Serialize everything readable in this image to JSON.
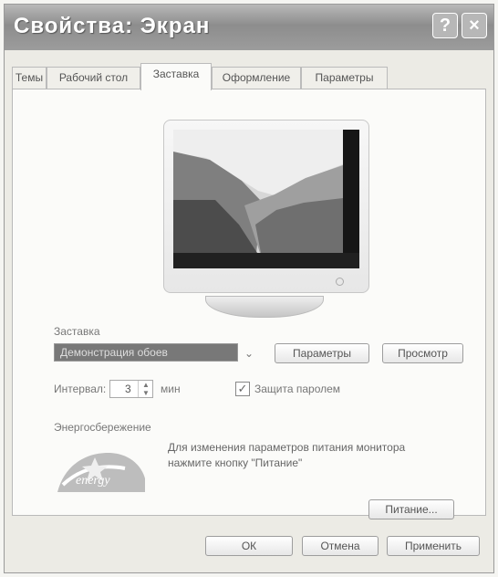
{
  "window": {
    "title": "Свойства: Экран",
    "help_button": "?",
    "close_button": "×"
  },
  "tabs": [
    {
      "label": "Темы"
    },
    {
      "label": "Рабочий стол"
    },
    {
      "label": "Заставка"
    },
    {
      "label": "Оформление"
    },
    {
      "label": "Параметры"
    }
  ],
  "screensaver": {
    "group_label": "Заставка",
    "selected_value": "Демонстрация обоев",
    "settings_button": "Параметры",
    "preview_button": "Просмотр",
    "interval_label": "Интервал:",
    "interval_value": "3",
    "interval_unit": "мин",
    "password_label": "Защита паролем",
    "password_checked": true
  },
  "power": {
    "group_label": "Энергосбережение",
    "description": "Для изменения параметров питания монитора нажмите кнопку \"Питание\"",
    "power_button": "Питание..."
  },
  "footer": {
    "ok": "ОК",
    "cancel": "Отмена",
    "apply": "Применить"
  }
}
